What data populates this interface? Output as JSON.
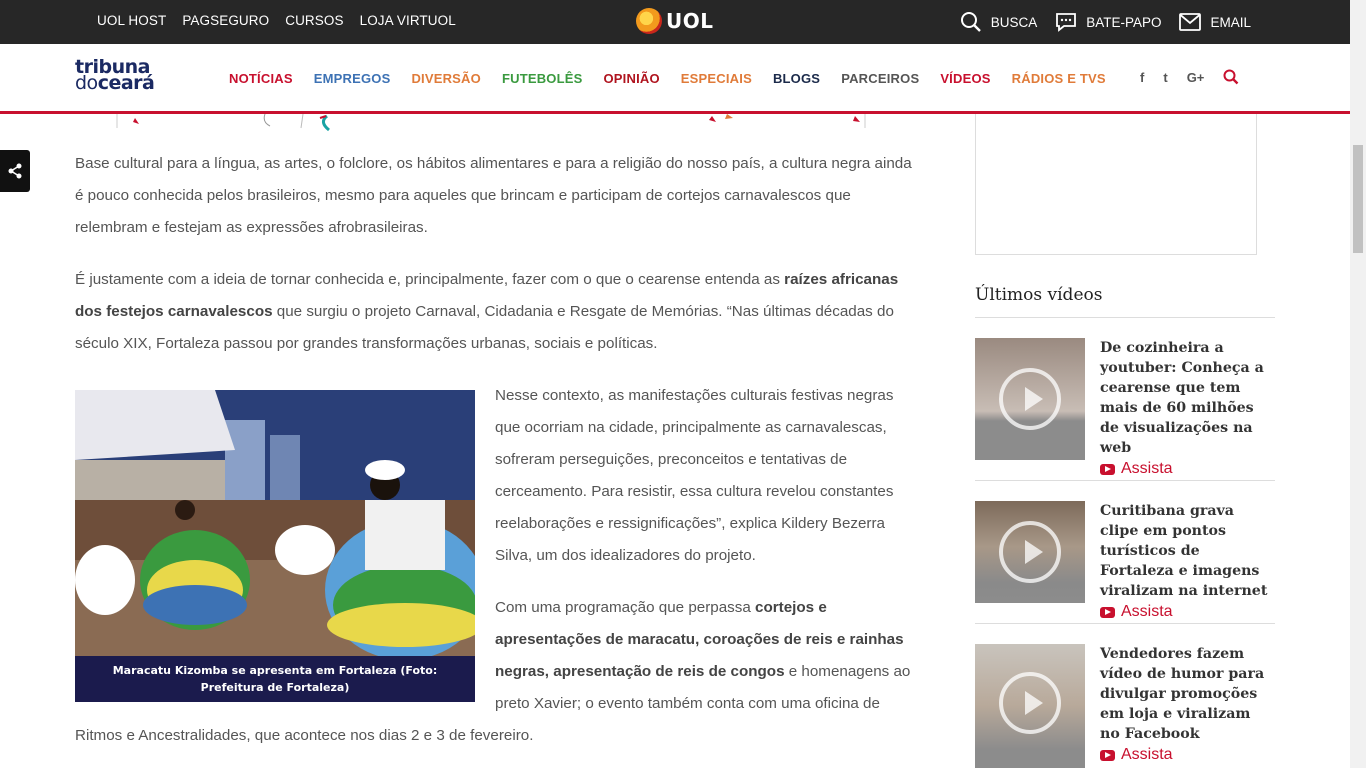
{
  "uol_bar": {
    "links": [
      "UOL HOST",
      "PAGSEGURO",
      "CURSOS",
      "LOJA VIRTUOL"
    ],
    "logo_text": "UOL",
    "right": [
      {
        "icon": "search-icon",
        "label": "BUSCA"
      },
      {
        "icon": "chat-icon",
        "label": "BATE-PAPO"
      },
      {
        "icon": "mail-icon",
        "label": "EMAIL"
      }
    ]
  },
  "header": {
    "brand_line1": "tribuna",
    "brand_line2_small": "do",
    "brand_line2_big": "ceará",
    "nav": [
      {
        "label": "NOTÍCIAS",
        "color": "#c8102e"
      },
      {
        "label": "EMPREGOS",
        "color": "#3d72b4"
      },
      {
        "label": "DIVERSÃO",
        "color": "#e07b39"
      },
      {
        "label": "FUTEBOLÊS",
        "color": "#3a9a3f"
      },
      {
        "label": "OPINIÃO",
        "color": "#b0141f"
      },
      {
        "label": "ESPECIAIS",
        "color": "#e07b39"
      },
      {
        "label": "BLOGS",
        "color": "#1b2a4a"
      },
      {
        "label": "PARCEIROS",
        "color": "#555555"
      },
      {
        "label": "VÍDEOS",
        "color": "#c8102e"
      },
      {
        "label": "RÁDIOS E TVS",
        "color": "#e07b39"
      }
    ],
    "social": [
      "f",
      "t",
      "G+"
    ],
    "accent": "#c8102e"
  },
  "article": {
    "p1": "Base cultural para a língua, as artes, o folclore, os hábitos alimentares e para a religião do nosso país, a cultura negra ainda é pouco conhecida pelos brasileiros, mesmo para aqueles que brincam e participam de cortejos carnavalescos que relembram e festejam as expressões afrobrasileiras.",
    "p2_a": "É justamente com a ideia de tornar conhecida e, principalmente, fazer com o que o cearense entenda as ",
    "p2_b": "raízes africanas dos festejos carnavalescos",
    "p2_c": " que surgiu o projeto Carnaval, Cidadania e Resgate de Memórias. “Nas últimas décadas do século XIX, Fortaleza passou por grandes transformações urbanas, sociais e políticas.",
    "caption": "Maracatu Kizomba se apresenta em Fortaleza (Foto: Prefeitura de Fortaleza)",
    "p3": "Nesse contexto, as manifestações culturais festivas negras que ocorriam na cidade, principalmente as carnavalescas, sofreram perseguições, preconceitos e tentativas de cerceamento. Para resistir, essa cultura revelou constantes reelaborações e ressignificações”, explica Kildery Bezerra Silva, um dos idealizadores do projeto.",
    "p4_a": "Com uma programação que perpassa ",
    "p4_b": "cortejos e apresentações de maracatu, coroações de reis e rainhas negras, apresentação de reis de congos",
    "p4_c": " e homenagens ao preto Xavier; o evento também conta com uma oficina de Ritmos e Ancestralidades, que acontece nos dias 2 e 3 de fevereiro."
  },
  "sidebar": {
    "title": "Últimos vídeos",
    "assista_label": "Assista",
    "videos": [
      {
        "title": "De cozinheira a youtuber: Conheça a cearense que tem mais de 60 milhões de visualizações na web"
      },
      {
        "title": "Curitibana grava clipe em pontos turísticos de Fortaleza e imagens viralizam na internet"
      },
      {
        "title": "Vendedores fazem vídeo de humor para divulgar promoções em loja e viralizam no Facebook"
      }
    ]
  }
}
